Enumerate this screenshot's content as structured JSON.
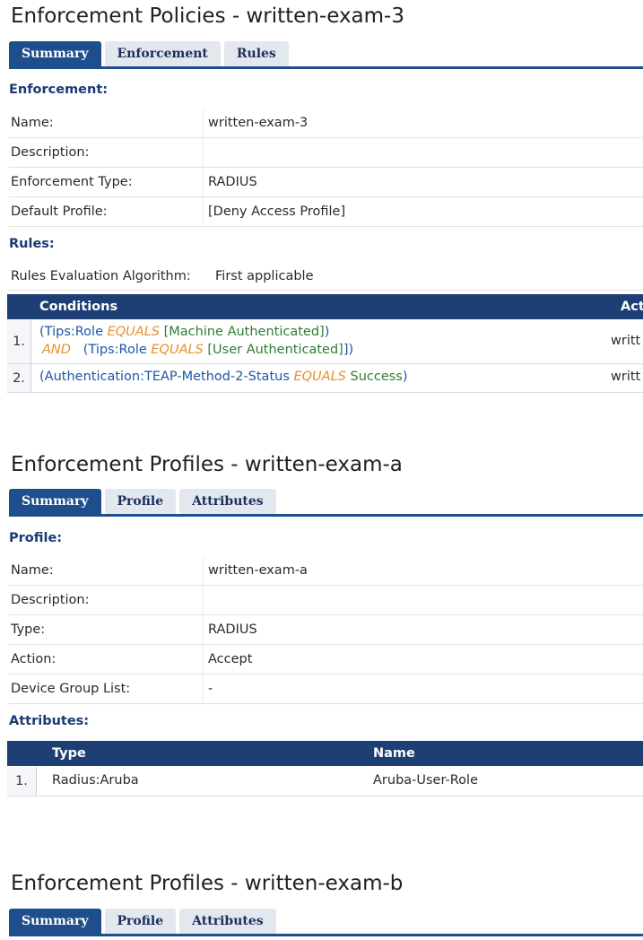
{
  "policy": {
    "title": "Enforcement Policies - written-exam-3",
    "tabs": [
      "Summary",
      "Enforcement",
      "Rules"
    ],
    "enforcement_heading": "Enforcement:",
    "fields": [
      {
        "label": "Name:",
        "value": "written-exam-3"
      },
      {
        "label": "Description:",
        "value": ""
      },
      {
        "label": "Enforcement Type:",
        "value": "RADIUS"
      },
      {
        "label": "Default Profile:",
        "value": "[Deny Access Profile]"
      }
    ],
    "rules_heading": "Rules:",
    "rules_algo_label": "Rules Evaluation Algorithm:",
    "rules_algo_value": "First applicable",
    "rules_columns": [
      "Conditions",
      "Act"
    ],
    "rules": [
      {
        "num": "1.",
        "line1": {
          "open": "(",
          "attr": "Tips:Role",
          "op": "EQUALS",
          "val": "[Machine Authenticated]",
          "close": ")"
        },
        "line2": {
          "and": "AND",
          "open": "(",
          "attr": "Tips:Role",
          "op": "EQUALS",
          "val": "[User Authenticated]",
          "close": "])"
        },
        "action": "writt"
      },
      {
        "num": "2.",
        "line1": {
          "open": "(",
          "attr": "Authentication:TEAP-Method-2-Status",
          "op": "EQUALS",
          "val": "Success",
          "close": ")"
        },
        "action": "writt"
      }
    ]
  },
  "profile_a": {
    "title": "Enforcement Profiles - written-exam-a",
    "tabs": [
      "Summary",
      "Profile",
      "Attributes"
    ],
    "profile_heading": "Profile:",
    "fields": [
      {
        "label": "Name:",
        "value": "written-exam-a"
      },
      {
        "label": "Description:",
        "value": ""
      },
      {
        "label": "Type:",
        "value": "RADIUS"
      },
      {
        "label": "Action:",
        "value": "Accept"
      },
      {
        "label": "Device Group List:",
        "value": "-"
      }
    ],
    "attributes_heading": "Attributes:",
    "attr_columns": [
      "Type",
      "Name"
    ],
    "attributes": [
      {
        "num": "1.",
        "type": "Radius:Aruba",
        "name": "Aruba-User-Role"
      }
    ]
  },
  "profile_b": {
    "title": "Enforcement Profiles - written-exam-b",
    "tabs": [
      "Summary",
      "Profile",
      "Attributes"
    ]
  }
}
